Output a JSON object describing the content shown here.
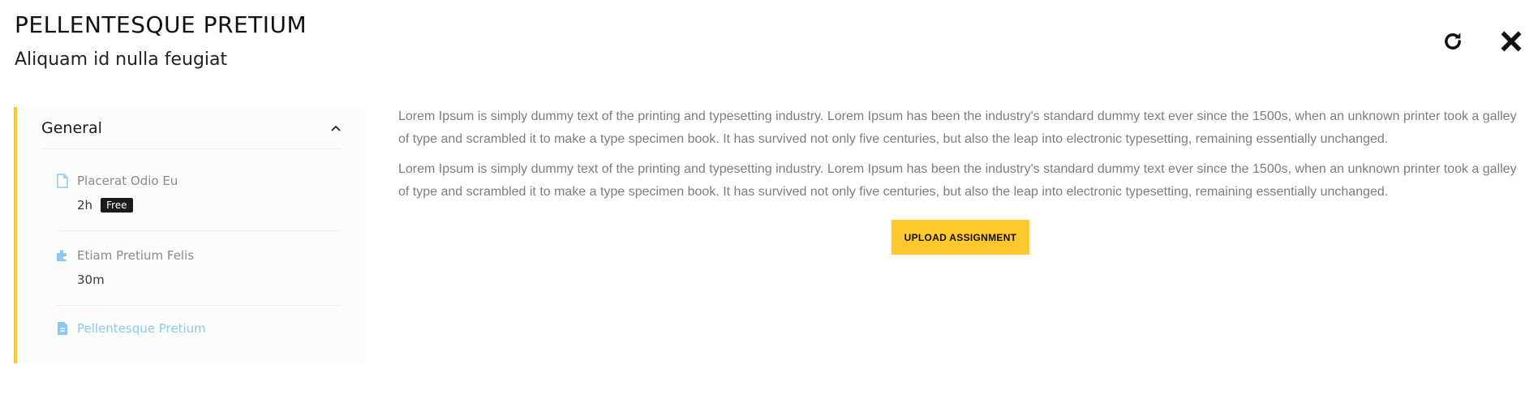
{
  "header": {
    "title": "PELLENTESQUE PRETIUM",
    "subtitle": "Aliquam id nulla feugiat"
  },
  "actions": {
    "refresh_icon": "refresh-icon",
    "close_icon": "close-icon"
  },
  "sidebar": {
    "section_label": "General",
    "lessons": [
      {
        "name": "Placerat Odio Eu",
        "duration": "2h",
        "badge": "Free",
        "icon": "file-outline-icon"
      },
      {
        "name": "Etiam Pretium Felis",
        "duration": "30m",
        "icon": "puzzle-icon"
      },
      {
        "name": "Pellentesque Pretium",
        "icon": "file-text-icon",
        "active": true
      }
    ]
  },
  "content": {
    "paragraphs": [
      "Lorem Ipsum is simply dummy text of the printing and typesetting industry. Lorem Ipsum has been the industry's standard dummy text ever since the 1500s, when an unknown printer took a galley of type and scrambled it to make a type specimen book. It has survived not only five centuries, but also the leap into electronic typesetting, remaining essentially unchanged.",
      "Lorem Ipsum is simply dummy text of the printing and typesetting industry. Lorem Ipsum has been the industry's standard dummy text ever since the 1500s, when an unknown printer took a galley of type and scrambled it to make a type specimen book. It has survived not only five centuries, but also the leap into electronic typesetting, remaining essentially unchanged."
    ],
    "upload_label": "UPLOAD ASSIGNMENT"
  },
  "colors": {
    "accent": "#ffc82c",
    "active_link": "#8ec7f2",
    "badge_bg": "#1b1b1b"
  }
}
